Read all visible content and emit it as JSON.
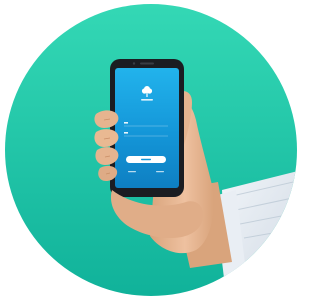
{
  "colors": {
    "background": "#ffffff",
    "circle_top": "#2fd0b3",
    "circle_bottom": "#12b99a",
    "phone_body": "#1b1d22",
    "screen_top": "#1aa9e6",
    "screen_bottom": "#0f8fd0",
    "skin": "#e7b690",
    "skin_shadow": "#c98f67",
    "shirt": "#e6ecf3"
  },
  "icons": {
    "app_logo": "tree-icon"
  }
}
